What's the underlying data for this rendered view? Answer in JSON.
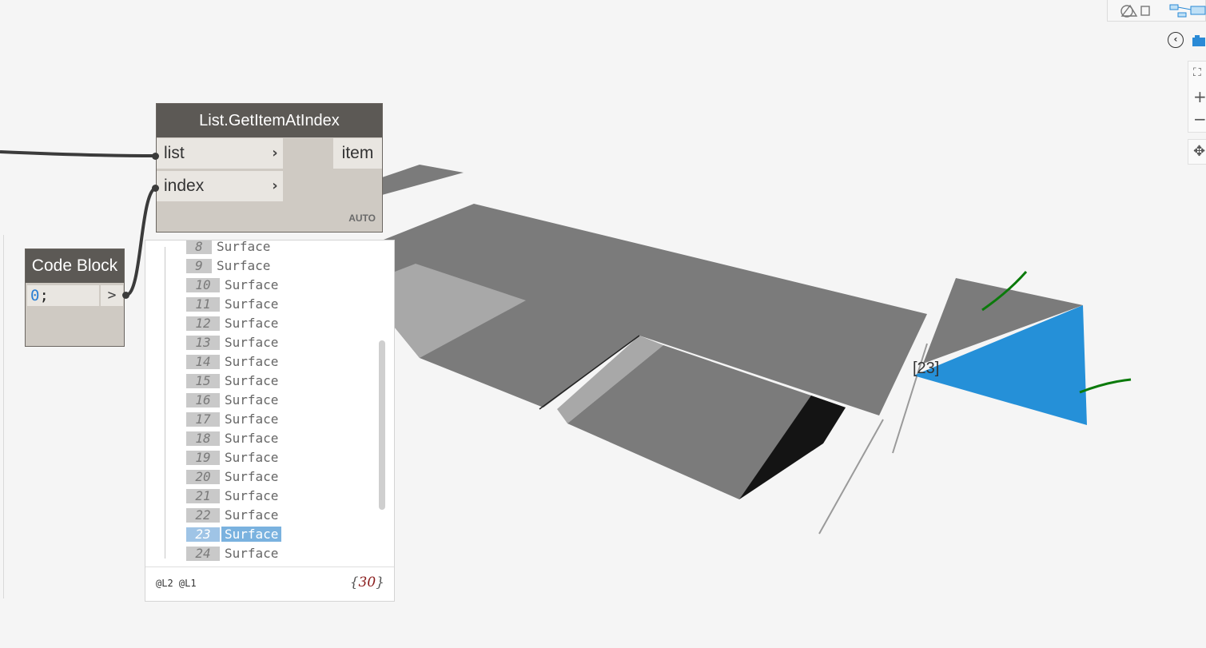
{
  "toolbar": {
    "icons": [
      "geometry-view-icon",
      "graph-view-icon"
    ],
    "back_icon": "chevron-left-icon",
    "camera_icon": "camera-icon",
    "zoom": {
      "fit": "fit-view-icon",
      "in": "+",
      "out": "−",
      "pan": "pan-icon"
    }
  },
  "node_get_item": {
    "title": "List.GetItemAtIndex",
    "inputs": [
      "list",
      "index"
    ],
    "output": "item",
    "lacing": "AUTO"
  },
  "node_code_block": {
    "title": "Code Block",
    "code_number": "0",
    "code_rest": ";",
    "output_symbol": ">"
  },
  "preview": {
    "rows": [
      {
        "index": "8",
        "value": "Surface"
      },
      {
        "index": "9",
        "value": "Surface"
      },
      {
        "index": "10",
        "value": "Surface"
      },
      {
        "index": "11",
        "value": "Surface"
      },
      {
        "index": "12",
        "value": "Surface"
      },
      {
        "index": "13",
        "value": "Surface"
      },
      {
        "index": "14",
        "value": "Surface"
      },
      {
        "index": "15",
        "value": "Surface"
      },
      {
        "index": "16",
        "value": "Surface"
      },
      {
        "index": "17",
        "value": "Surface"
      },
      {
        "index": "18",
        "value": "Surface"
      },
      {
        "index": "19",
        "value": "Surface"
      },
      {
        "index": "20",
        "value": "Surface"
      },
      {
        "index": "21",
        "value": "Surface"
      },
      {
        "index": "22",
        "value": "Surface"
      },
      {
        "index": "23",
        "value": "Surface"
      },
      {
        "index": "24",
        "value": "Surface"
      }
    ],
    "selected_index": "23",
    "levels": "@L2 @L1",
    "count": "30"
  },
  "viewport": {
    "selected_label": "[23]",
    "colors": {
      "surface": "#7b7b7b",
      "selected": "#2590d8",
      "background": "#f5f5f5",
      "wire": "#3b3b3b"
    }
  }
}
